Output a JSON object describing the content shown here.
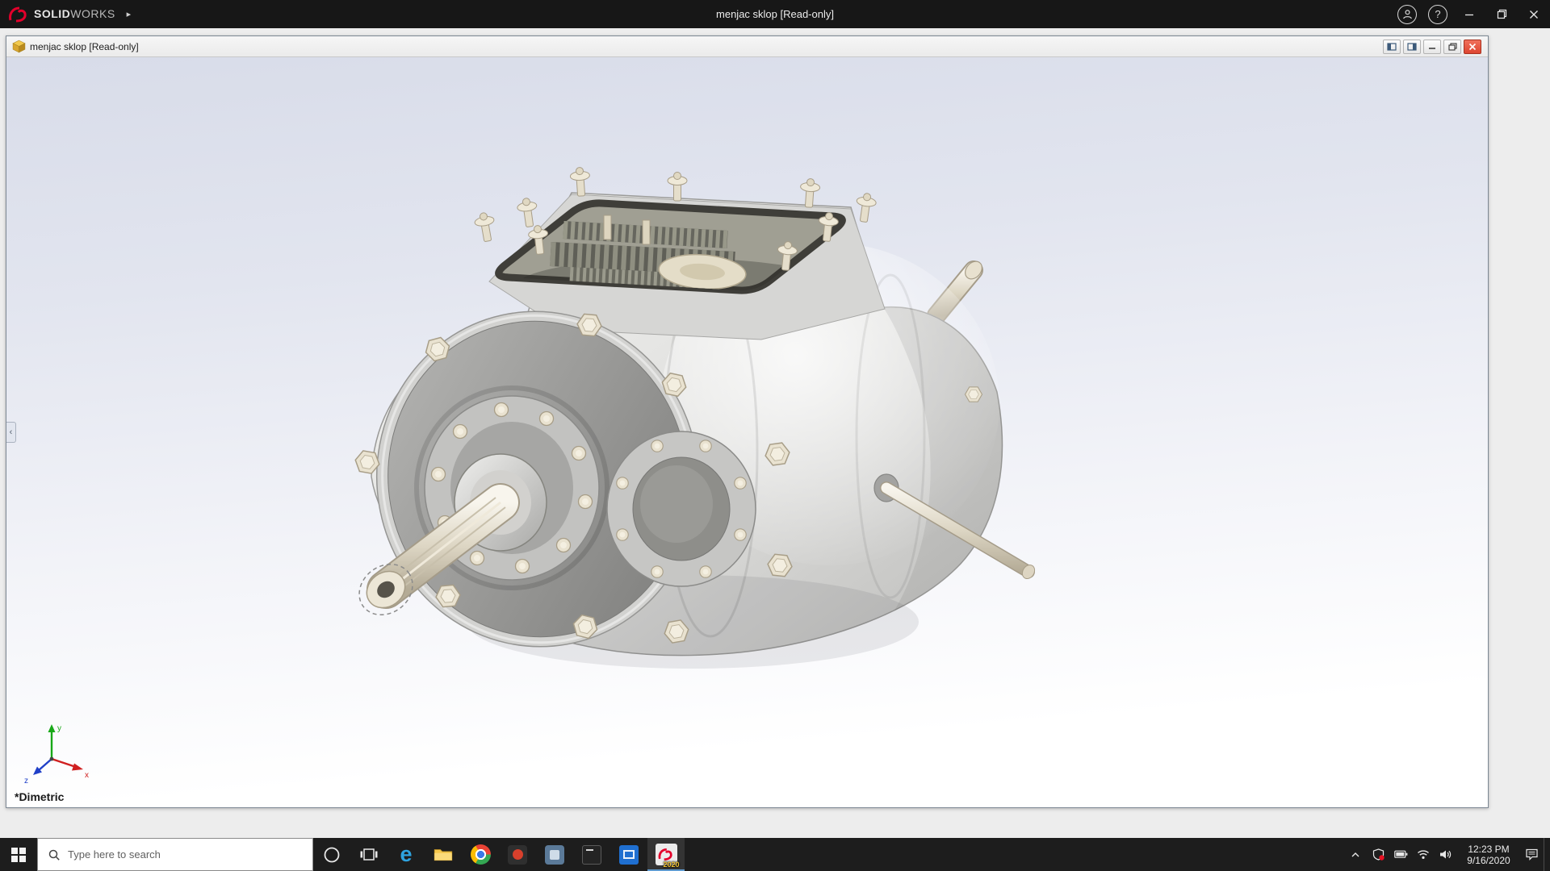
{
  "app": {
    "brand": {
      "solid": "SOLID",
      "works": "WORKS",
      "arrow": "▸"
    },
    "title": "menjac sklop [Read-only]"
  },
  "document": {
    "title": "menjac sklop [Read-only]",
    "orientation_label": "*Dimetric",
    "triad": {
      "x": "x",
      "y": "y",
      "z": "z"
    }
  },
  "taskbar": {
    "search_placeholder": "Type here to search",
    "solidworks_version_badge": "2020",
    "clock": {
      "time": "12:23 PM",
      "date": "9/16/2020"
    }
  },
  "icons": {
    "help_glyph": "?"
  },
  "colors": {
    "brand_red": "#e4002b",
    "titlebar_bg": "#171717",
    "taskbar_bg": "#1d1d1d",
    "doc_close_button": "#dd4530",
    "viewport_gradient_top": "#d8dce9",
    "viewport_gradient_bottom": "#ffffff",
    "triad_x_color": "#d02020",
    "triad_y_color": "#18a818",
    "triad_z_color": "#2040c8"
  }
}
